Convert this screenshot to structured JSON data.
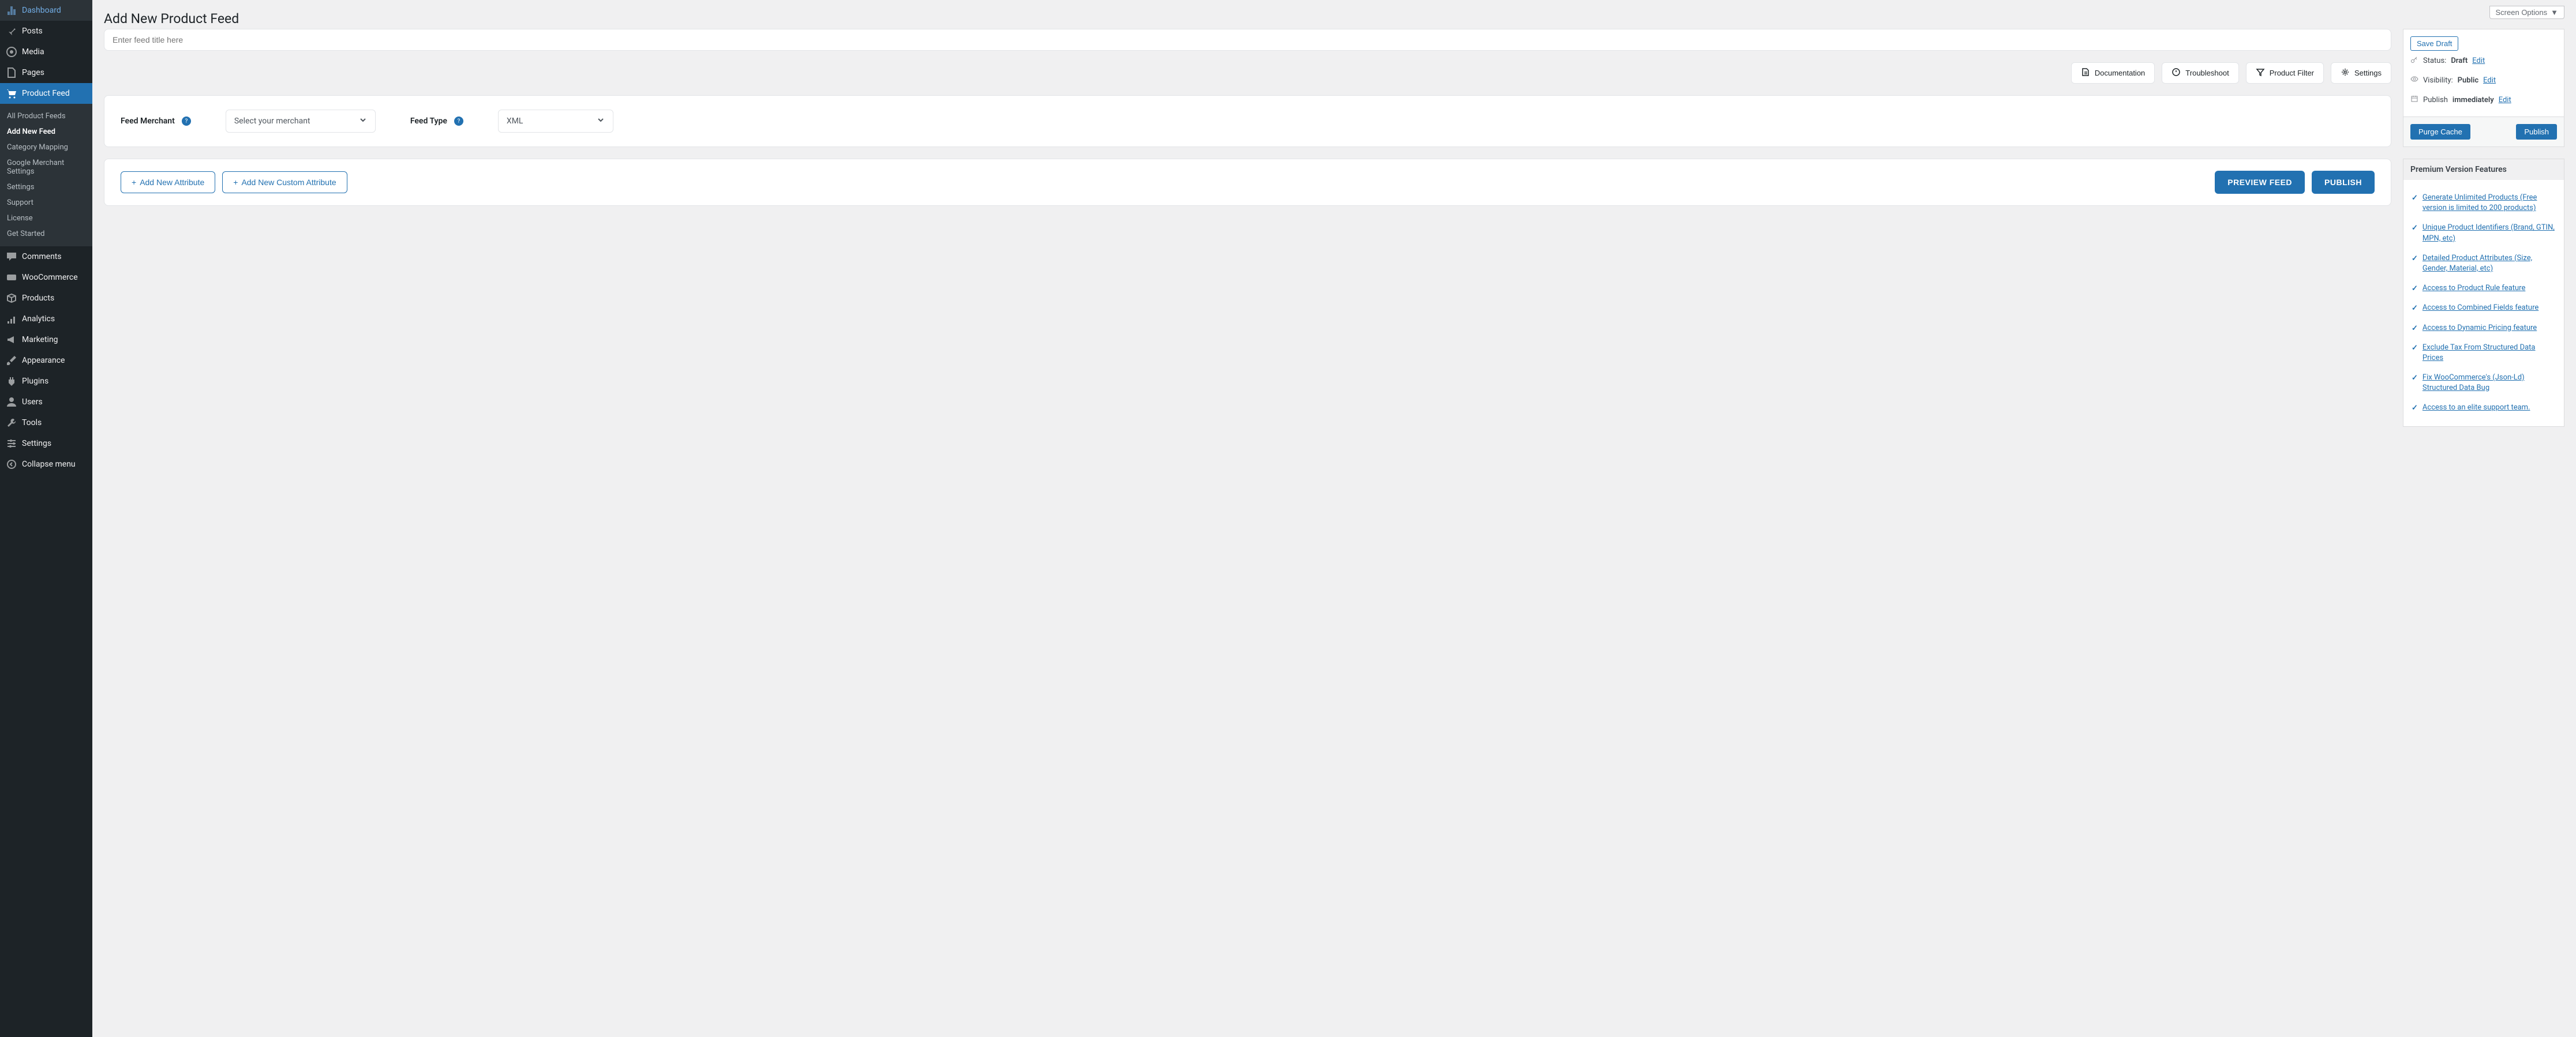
{
  "screen_options": "Screen Options",
  "page_title": "Add New Product Feed",
  "title_placeholder": "Enter feed title here",
  "sidebar": {
    "items": [
      {
        "label": "Dashboard",
        "icon": "dashboard"
      },
      {
        "label": "Posts",
        "icon": "pin"
      },
      {
        "label": "Media",
        "icon": "media"
      },
      {
        "label": "Pages",
        "icon": "page"
      },
      {
        "label": "Product Feed",
        "icon": "cart",
        "active": true
      },
      {
        "label": "Comments",
        "icon": "comment"
      },
      {
        "label": "WooCommerce",
        "icon": "woo"
      },
      {
        "label": "Products",
        "icon": "box"
      },
      {
        "label": "Analytics",
        "icon": "chart"
      },
      {
        "label": "Marketing",
        "icon": "megaphone"
      },
      {
        "label": "Appearance",
        "icon": "brush"
      },
      {
        "label": "Plugins",
        "icon": "plug"
      },
      {
        "label": "Users",
        "icon": "user"
      },
      {
        "label": "Tools",
        "icon": "wrench"
      },
      {
        "label": "Settings",
        "icon": "sliders"
      },
      {
        "label": "Collapse menu",
        "icon": "collapse"
      }
    ],
    "submenu": [
      "All Product Feeds",
      "Add New Feed",
      "Category Mapping",
      "Google Merchant Settings",
      "Settings",
      "Support",
      "License",
      "Get Started"
    ]
  },
  "actions": {
    "documentation": "Documentation",
    "troubleshoot": "Troubleshoot",
    "product_filter": "Product Filter",
    "settings": "Settings"
  },
  "form": {
    "merchant_label": "Feed Merchant",
    "merchant_placeholder": "Select your merchant",
    "type_label": "Feed Type",
    "type_value": "XML"
  },
  "buttons": {
    "add_attr": "Add New Attribute",
    "add_custom": "Add New Custom Attribute",
    "preview": "PREVIEW FEED",
    "publish_main": "PUBLISH"
  },
  "publish_box": {
    "save_draft": "Save Draft",
    "status_label": "Status:",
    "status_value": "Draft",
    "visibility_label": "Visibility:",
    "visibility_value": "Public",
    "publish_label": "Publish",
    "publish_value": "immediately",
    "edit": "Edit",
    "purge": "Purge Cache",
    "publish": "Publish"
  },
  "premium": {
    "title": "Premium Version Features",
    "features": [
      "Generate Unlimited Products (Free version is limited to 200 products)",
      "Unique Product Identifiers (Brand, GTIN, MPN, etc)",
      "Detailed Product Attributes (Size, Gender, Material, etc)",
      "Access to Product Rule feature",
      "Access to Combined Fields feature",
      "Access to Dynamic Pricing feature",
      "Exclude Tax From Structured Data Prices",
      "Fix WooCommerce's (Json-Ld) Structured Data Bug",
      "Access to an elite support team."
    ]
  }
}
